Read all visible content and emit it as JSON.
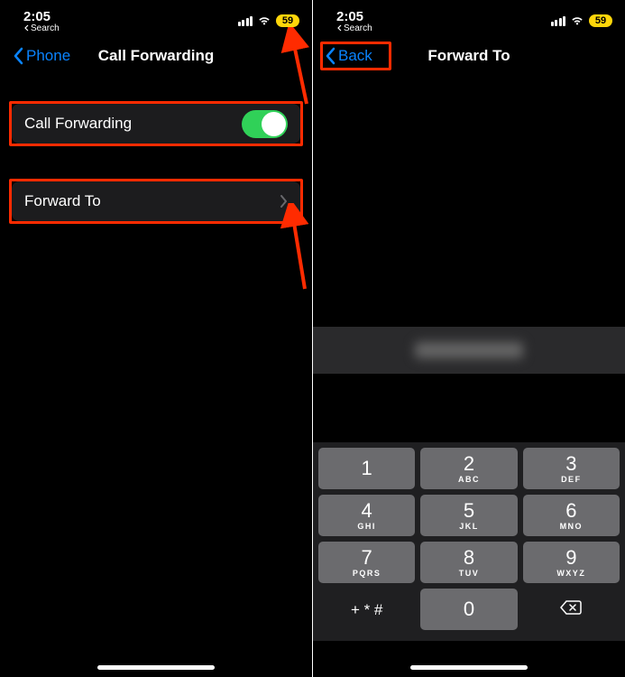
{
  "status": {
    "time": "2:05",
    "back_label": "Search",
    "battery": "59"
  },
  "left": {
    "nav_back": "Phone",
    "nav_title": "Call Forwarding",
    "row_toggle_label": "Call Forwarding",
    "row_forward_label": "Forward To"
  },
  "right": {
    "nav_back": "Back",
    "nav_title": "Forward To"
  },
  "keypad": {
    "keys": [
      {
        "num": "1",
        "sub": ""
      },
      {
        "num": "2",
        "sub": "ABC"
      },
      {
        "num": "3",
        "sub": "DEF"
      },
      {
        "num": "4",
        "sub": "GHI"
      },
      {
        "num": "5",
        "sub": "JKL"
      },
      {
        "num": "6",
        "sub": "MNO"
      },
      {
        "num": "7",
        "sub": "PQRS"
      },
      {
        "num": "8",
        "sub": "TUV"
      },
      {
        "num": "9",
        "sub": "WXYZ"
      }
    ],
    "symbols": "+ * #",
    "zero": "0"
  }
}
